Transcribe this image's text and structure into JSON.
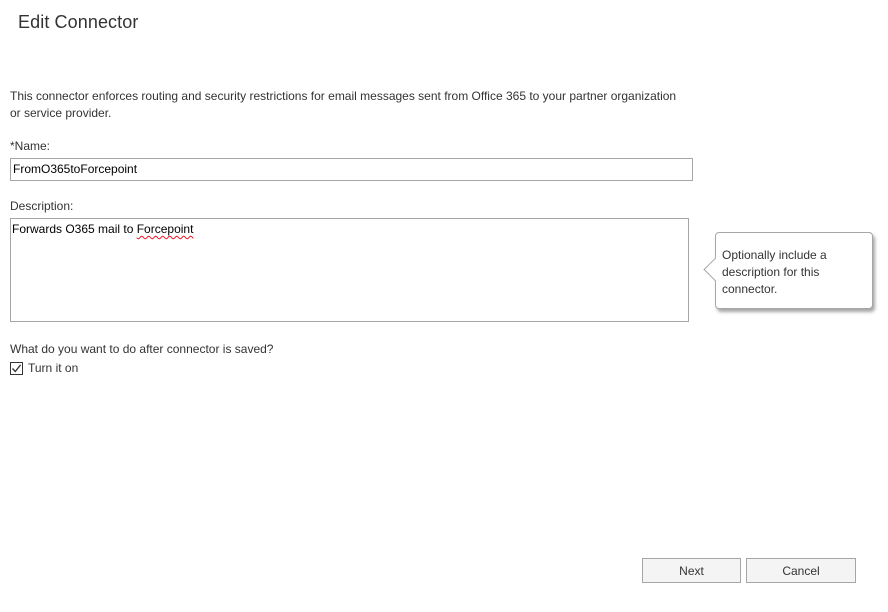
{
  "dialog": {
    "title": "Edit Connector",
    "intro": "This connector enforces routing and security restrictions for email messages sent from Office 365 to your partner organization or service provider."
  },
  "form": {
    "name_label": "*Name:",
    "name_value": "FromO365toForcepoint",
    "description_label": "Description:",
    "description_value_prefix": "Forwards O365 mail to ",
    "description_value_misspelled": "Forcepoint",
    "after_save_question": "What do you want to do after connector is saved?",
    "turn_on_label": "Turn it on",
    "turn_on_checked": true
  },
  "callout": {
    "text": "Optionally include a description for this connector."
  },
  "buttons": {
    "next_label": "Next",
    "cancel_label": "Cancel"
  },
  "icons": {
    "checkbox": "checkmark-icon"
  },
  "colors": {
    "border": "#a6a6a6",
    "button_bg": "#f4f4f4",
    "text": "#333333",
    "spellcheck": "#e81123"
  }
}
